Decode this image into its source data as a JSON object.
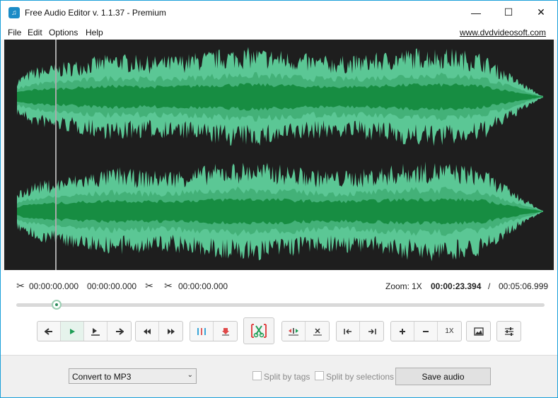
{
  "window": {
    "title": "Free Audio Editor v. 1.1.37 - Premium",
    "min_glyph": "—",
    "max_glyph": "☐",
    "close_glyph": "✕"
  },
  "menu": {
    "items": [
      "File",
      "Edit",
      "Options",
      "Help"
    ],
    "link": "www.dvdvideosoft.com"
  },
  "selection": {
    "start": "00:00:00.000",
    "end": "00:00:00.000",
    "cut_length": "00:00:00.000",
    "zoom_label": "Zoom:",
    "zoom_value": "1X",
    "position": "00:00:23.394",
    "separator": "/",
    "duration": "00:05:06.999"
  },
  "playback": {
    "progress_fraction": 0.076
  },
  "toolbar": {
    "zoom_level": "1X"
  },
  "bottom": {
    "format_value": "Convert to MP3",
    "split_by_tags": "Split by tags",
    "split_by_selections": "Split by selections",
    "save_label": "Save audio"
  },
  "colors": {
    "accent": "#2a9d5c",
    "wave_fill": "#5bc795",
    "wave_core": "#138a3c",
    "wave_bg": "#1e1e1e",
    "window_border": "#1a9fd9"
  }
}
